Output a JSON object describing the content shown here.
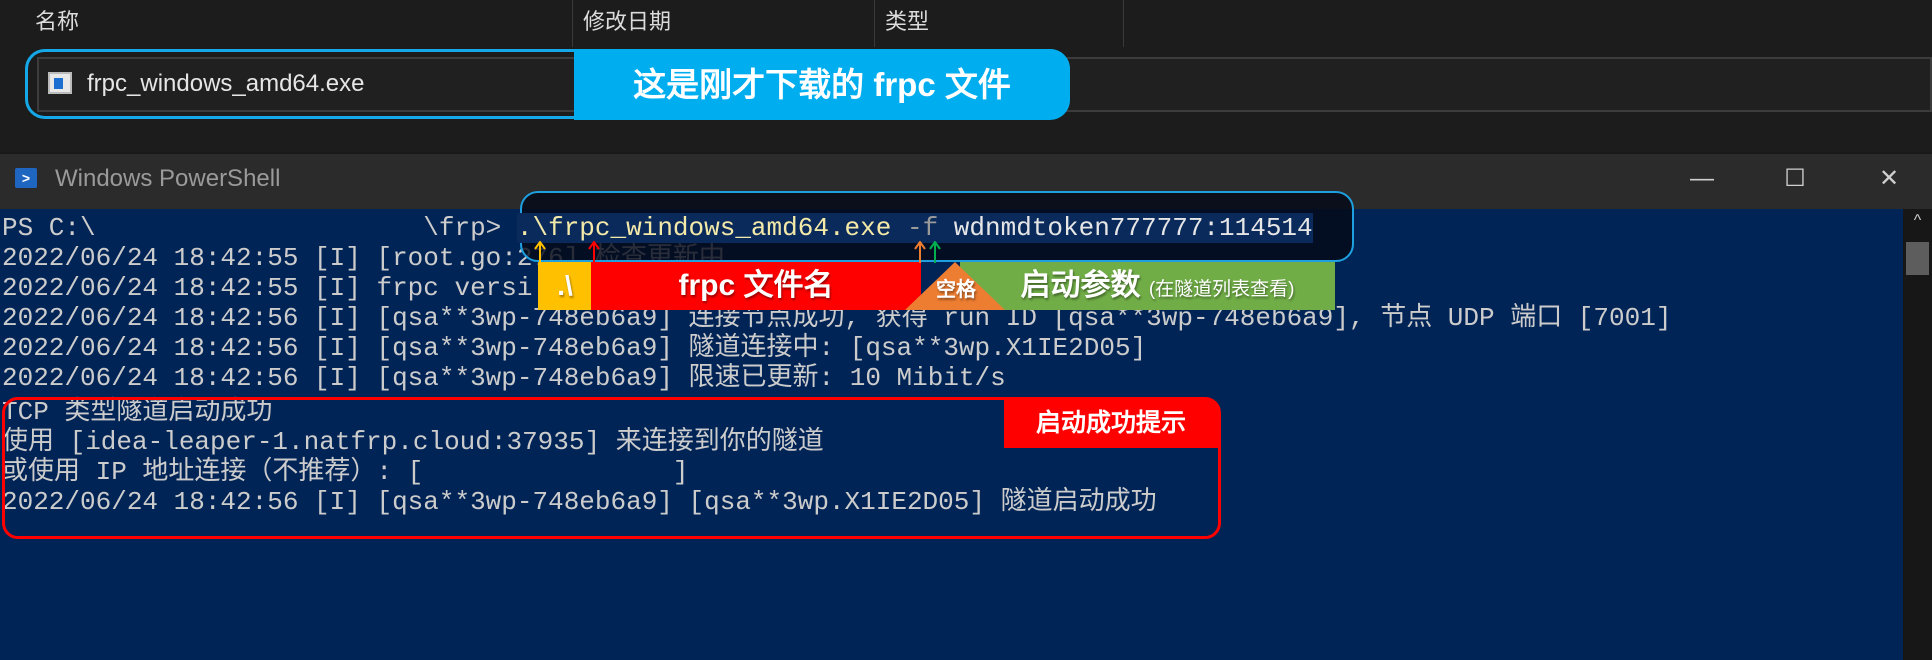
{
  "explorer": {
    "columns": [
      "名称",
      "修改日期",
      "类型"
    ],
    "file_name": "frpc_windows_amd64.exe",
    "callout": "这是刚才下载的 frpc 文件"
  },
  "window": {
    "title": "Windows PowerShell",
    "minimize": "—",
    "maximize": "☐",
    "close": "✕",
    "scroll_up": "^"
  },
  "console": {
    "prompt": "PS C:\\                     \\frp> ",
    "cmd_exe": ".\\frpc_windows_amd64.exe",
    "cmd_flag": " -f ",
    "cmd_arg": "wdnmdtoken777777:114514",
    "lines": [
      "2022/06/24 18:42:55 [I] [root.go:276] 检查更新中",
      "2022/06/24 18:42:55 [I] frpc versi",
      "2022/06/24 18:42:56 [I] [qsa**3wp-748eb6a9] 连接节点成功, 获得 run ID [qsa**3wp-748eb6a9], 节点 UDP 端口 [7001]",
      "2022/06/24 18:42:56 [I] [qsa**3wp-748eb6a9] 隧道连接中: [qsa**3wp.X1IE2D05]",
      "2022/06/24 18:42:56 [I] [qsa**3wp-748eb6a9] 限速已更新: 10 Mibit/s",
      "TCP 类型隧道启动成功",
      "使用 [idea-leaper-1.natfrp.cloud:37935] 来连接到你的隧道",
      "或使用 IP 地址连接（不推荐）: [                ]",
      "2022/06/24 18:42:56 [I] [qsa**3wp-748eb6a9] [qsa**3wp.X1IE2D05] 隧道启动成功"
    ]
  },
  "annotations": {
    "dot_label": ".\\",
    "name_label": "frpc 文件名",
    "space_label": "空格",
    "args_label": "启动参数",
    "args_note": "(在隧道列表查看)",
    "success_label": "启动成功提示",
    "colors": {
      "blue": "#00aeef",
      "yellow": "#ffc000",
      "red": "#ff0000",
      "orange": "#ed7d31",
      "green": "#70ad47"
    }
  }
}
